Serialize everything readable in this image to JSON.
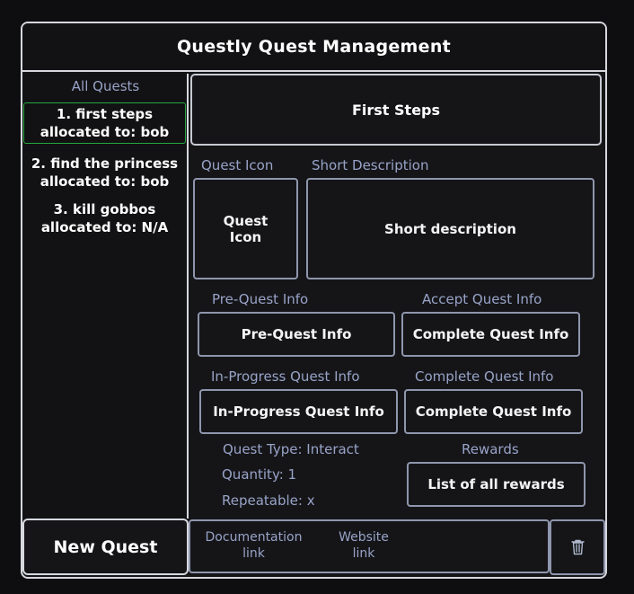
{
  "app": {
    "title": "Questly Quest Management"
  },
  "sidebar": {
    "title": "All Quests",
    "items": [
      {
        "line1": "1. first steps",
        "line2": "allocated to: bob",
        "selected": true
      },
      {
        "line1": "2. find the princess",
        "line2": "allocated to: bob",
        "selected": false
      },
      {
        "line1": "3. kill gobbos",
        "line2": "allocated to: N/A",
        "selected": false
      }
    ],
    "new_quest_label": "New Quest"
  },
  "detail": {
    "quest_name": "First Steps",
    "quest_icon_label": "Quest Icon",
    "quest_icon_line1": "Quest",
    "quest_icon_line2": "Icon",
    "short_desc_label": "Short Description",
    "short_desc_value": "Short description",
    "pre_quest_label": "Pre-Quest Info",
    "pre_quest_value": "Pre-Quest Info",
    "accept_quest_label": "Accept Quest Info",
    "accept_quest_value": "Complete Quest Info",
    "in_progress_label": "In-Progress Quest Info",
    "in_progress_value": "In-Progress Quest Info",
    "complete_quest_label": "Complete Quest Info",
    "complete_quest_value": "Complete Quest Info",
    "quest_type": "Quest Type: Interact",
    "quantity": "Quantity: 1",
    "repeatable": "Repeatable: x",
    "rewards_label": "Rewards",
    "rewards_value": "List of all rewards"
  },
  "footer": {
    "documentation_line1": "Documentation",
    "documentation_line2": "link",
    "website_line1": "Website",
    "website_line2": "link",
    "trash_icon": "trash-icon"
  },
  "colors": {
    "background": "#0e0e10",
    "border": "#d6d8de",
    "muted_border": "#8f96ad",
    "label": "#98a3c7",
    "selected": "#23a83e"
  }
}
